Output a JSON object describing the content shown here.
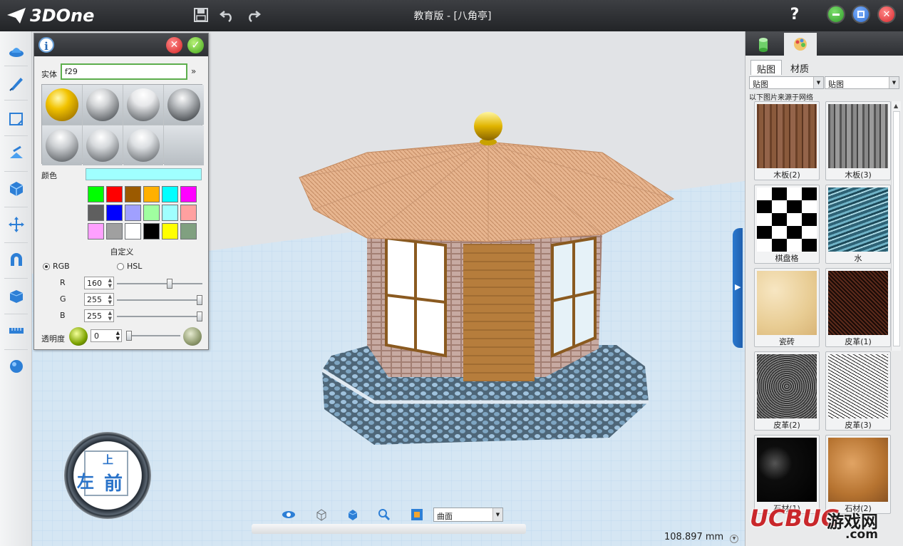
{
  "app": {
    "logo_text": "3DOne",
    "window_title": "教育版 - [八角亭]",
    "help_label": "?"
  },
  "toolbar": {
    "items": [
      "save-icon",
      "undo-icon",
      "redo-icon"
    ]
  },
  "window_controls": {
    "minimize_color": "#3aaa35",
    "maximize_color": "#2f6fd0",
    "close_color": "#d9262b"
  },
  "left_toolbar": {
    "items": [
      "basic-shape-icon",
      "sketch-icon",
      "sketch-edit-icon",
      "special-function-icon",
      "solid-edit-icon",
      "transform-icon",
      "combine-icon",
      "measure-icon",
      "distance-icon",
      "render-icon"
    ]
  },
  "material_panel": {
    "info_label": "i",
    "cancel_label": "✕",
    "ok_label": "✓",
    "entity_label": "实体",
    "entity_value": "f29",
    "color_label": "颜色",
    "current_color": "#a0ffff",
    "palette": [
      "#00ff00",
      "#ff0000",
      "#9b5a00",
      "#ffb000",
      "#00ffff",
      "#ff00ff",
      "#5f5f5f",
      "#0000ff",
      "#a0a0ff",
      "#a0ffa0",
      "#a0ffff",
      "#ffa0a0",
      "#ffa0ff",
      "#a0a0a0",
      "#ffffff",
      "#000000",
      "#ffff00",
      "#80a080"
    ],
    "custom_label": "自定义",
    "rgb_label": "RGB",
    "hsl_label": "HSL",
    "r_label": "R",
    "g_label": "G",
    "b_label": "B",
    "r_value": "160",
    "g_value": "255",
    "b_value": "255",
    "r_fraction": 0.627,
    "g_fraction": 1.0,
    "b_fraction": 1.0,
    "transparency_label": "透明度",
    "transparency_value": "0",
    "transparency_fraction": 0.0
  },
  "right_panel": {
    "tab_texture": "贴图",
    "tab_material": "材质",
    "select_left": "贴图",
    "select_right": "贴图",
    "source_note": "以下图片来源于网络",
    "textures": [
      {
        "label": "木板(2)",
        "kind": "wood"
      },
      {
        "label": "木板(3)",
        "kind": "woodgray"
      },
      {
        "label": "棋盘格",
        "kind": "checker"
      },
      {
        "label": "水",
        "kind": "water"
      },
      {
        "label": "瓷砖",
        "kind": "tile"
      },
      {
        "label": "皮革(1)",
        "kind": "leather1"
      },
      {
        "label": "皮革(2)",
        "kind": "leather2"
      },
      {
        "label": "皮革(3)",
        "kind": "leather3"
      },
      {
        "label": "石材(1)",
        "kind": "stone1"
      },
      {
        "label": "石材(2)",
        "kind": "stone2"
      }
    ]
  },
  "bottom": {
    "view_select": "曲面",
    "measurement": "108.897 mm"
  },
  "view_cube": {
    "left_label": "左",
    "front_label": "前",
    "top_label": "上"
  },
  "watermark": {
    "brand": "UCBUG",
    "cn": "游戏网",
    "com": ".com"
  }
}
